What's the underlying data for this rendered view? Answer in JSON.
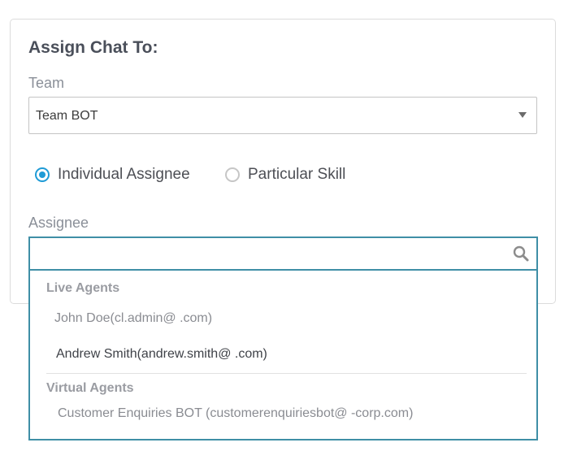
{
  "form": {
    "title": "Assign Chat To:",
    "team_label": "Team",
    "team_value": "Team BOT",
    "assignment_options": [
      {
        "label": "Individual Assignee",
        "checked": true
      },
      {
        "label": "Particular Skill",
        "checked": false
      }
    ],
    "assignee_label": "Assignee",
    "search_value": ""
  },
  "dropdown": {
    "groups": [
      {
        "label": "Live Agents",
        "items": [
          "John Doe(cl.admin@          .com)",
          "Andrew Smith(andrew.smith@          .com)"
        ]
      },
      {
        "label": "Virtual Agents",
        "items": [
          "Customer Enquiries BOT (customerenquiriesbot@          -corp.com)"
        ]
      }
    ]
  },
  "colors": {
    "accent": "#1f9bd6",
    "input_focus_border": "#3f8fa6",
    "title_text": "#4a4f5a",
    "label_text": "#8a8f98"
  },
  "icons": {
    "search": "search-icon",
    "caret": "chevron-down-icon"
  }
}
